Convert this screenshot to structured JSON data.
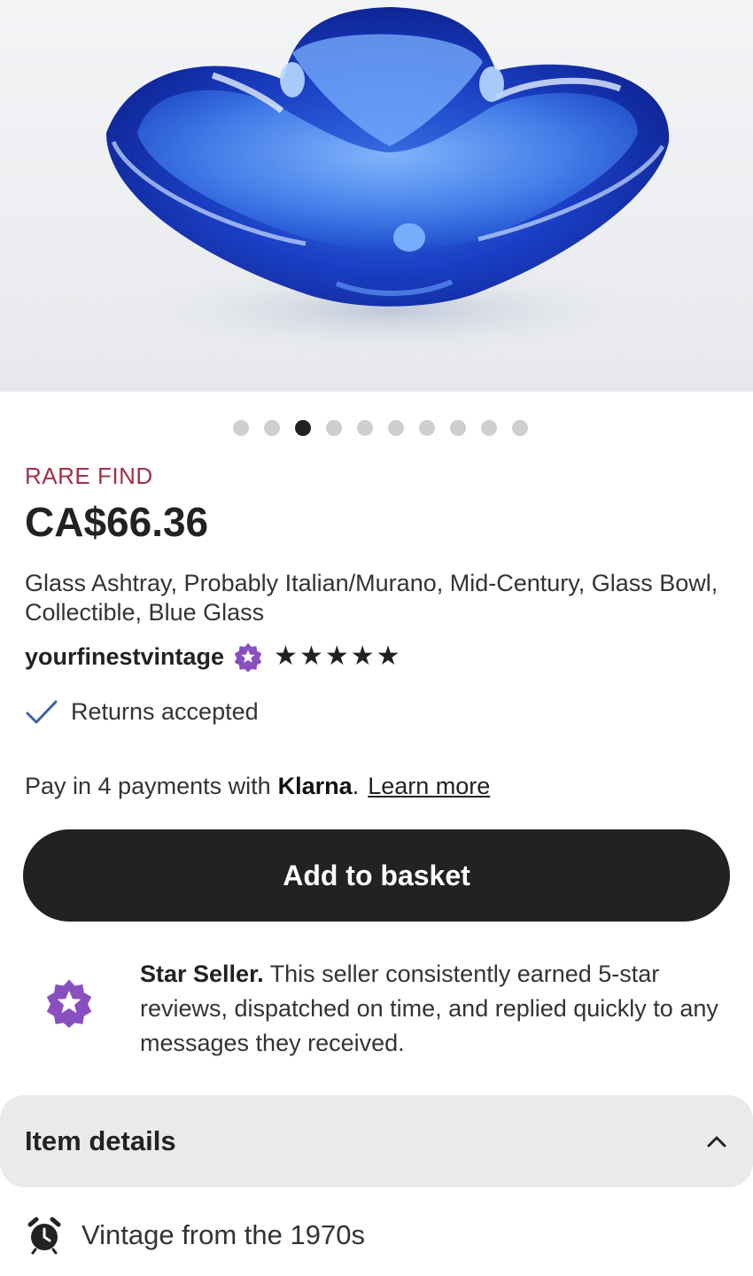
{
  "gallery": {
    "image_alt": "Blue glass ashtray",
    "dot_count": 10,
    "active_index": 2
  },
  "listing": {
    "badge": "RARE FIND",
    "price": "CA$66.36",
    "title": "Glass Ashtray, Probably Italian/Murano, Mid-Century, Glass Bowl, Collectible, Blue Glass"
  },
  "seller": {
    "name": "yourfinestvintage",
    "rating": 5,
    "badge_icon": "star-seller-badge-icon"
  },
  "returns": {
    "label": "Returns accepted",
    "icon": "check-icon"
  },
  "klarna": {
    "prefix": "Pay in 4 payments with",
    "brand": "Klarna",
    "separator": ".",
    "link": "Learn more"
  },
  "actions": {
    "add_to_basket": "Add to basket"
  },
  "star_seller": {
    "heading": "Star Seller.",
    "body": "This seller consistently earned 5-star reviews, dispatched on time, and replied quickly to any messages they received."
  },
  "item_details": {
    "title": "Item details",
    "icon": "chevron-up-icon",
    "vintage": "Vintage from the 1970s"
  },
  "colors": {
    "accent_badge": "#a1304a",
    "button_bg": "#222222",
    "star_seller_purple": "#8a4fbf",
    "check_blue": "#3b5fa8"
  }
}
